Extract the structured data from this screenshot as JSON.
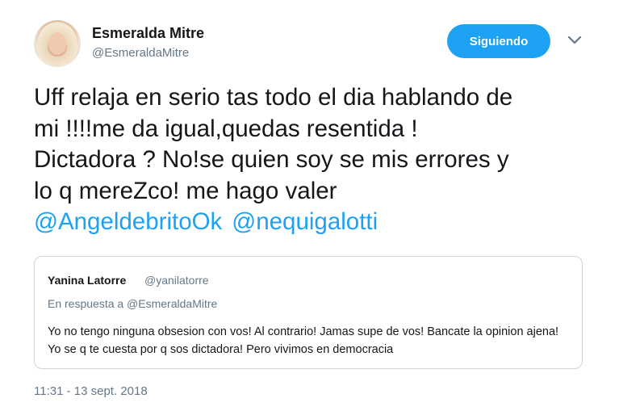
{
  "author": {
    "display_name": "Esmeralda Mitre",
    "handle": "@EsmeraldaMitre"
  },
  "follow_button_label": "Siguiendo",
  "tweet": {
    "text": "Uff relaja en serio tas todo el dia hablando de\nmi !!!!me da igual,quedas resentida !\nDictadora ? No!se quien soy  se mis errores y\nlo q mereZco! me hago valer",
    "mentions": [
      "@AngeldebritoOk",
      "@nequigalotti"
    ]
  },
  "quoted_tweet": {
    "display_name": "Yanina Latorre",
    "handle": "@yanilatorre",
    "reply_to": "En respuesta a @EsmeraldaMitre",
    "text": "Yo no tengo ninguna obsesion con vos! Al contrario! Jamas supe de vos! Bancate la opinion ajena! Yo se q te cuesta por q sos dictadora! Pero vivimos en democracia"
  },
  "timestamp": "11:31 - 13 sept. 2018",
  "icons": {
    "avatar": "profile-photo",
    "menu": "chevron-down-icon"
  },
  "colors": {
    "accent": "#1da1f2",
    "secondary_text": "#657786",
    "border": "#ccd6dd"
  }
}
